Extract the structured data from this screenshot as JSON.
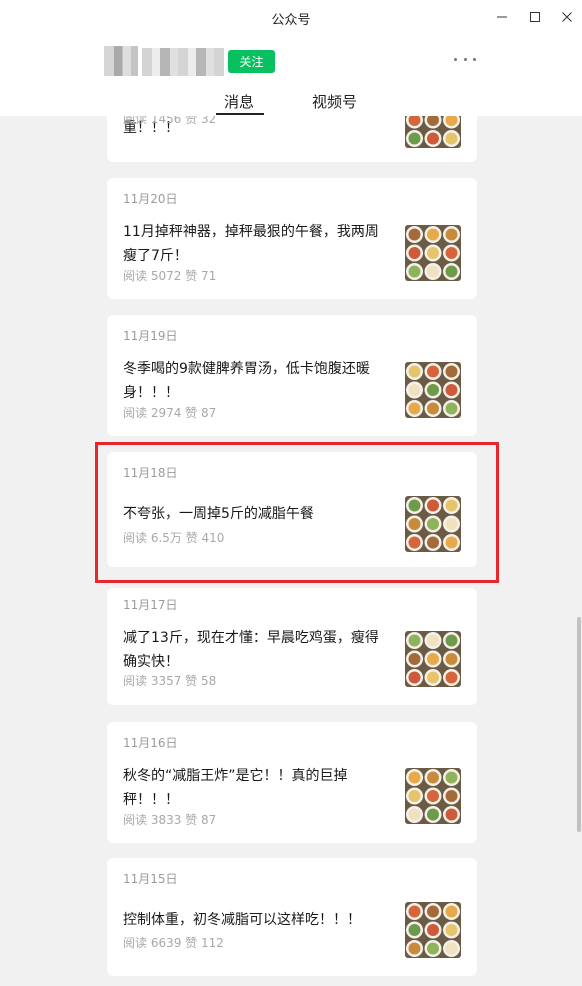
{
  "window": {
    "title": "公众号"
  },
  "account": {
    "name": "[blurred]",
    "follow_label": "关注"
  },
  "tabs": [
    {
      "label": "消息"
    },
    {
      "label": "视频号"
    }
  ],
  "articles": [
    {
      "date": "",
      "title": "重！！！",
      "stats": "阅读 1456  赞 32",
      "thumb": "food-photo"
    },
    {
      "date": "11月20日",
      "title": "11月掉秤神器，掉秤最狠的午餐，我两周瘦了7斤！",
      "stats": "阅读 5072  赞 71",
      "thumb": "food-photo"
    },
    {
      "date": "11月19日",
      "title": "冬季喝的9款健脾养胃汤，低卡饱腹还暖身！！！",
      "stats": "阅读 2974  赞 87",
      "thumb": "food-photo"
    },
    {
      "date": "11月18日",
      "title": "不夸张，一周掉5斤的减脂午餐",
      "stats": "阅读 6.5万  赞 410",
      "thumb": "food-photo",
      "highlighted": true
    },
    {
      "date": "11月17日",
      "title": "减了13斤，现在才懂：早晨吃鸡蛋，瘦得确实快！",
      "stats": "阅读 3357  赞 58",
      "thumb": "food-photo"
    },
    {
      "date": "11月16日",
      "title": "秋冬的“减脂王炸”是它！！真的巨掉秤！！！",
      "stats": "阅读 3833  赞 87",
      "thumb": "food-photo"
    },
    {
      "date": "11月15日",
      "title": "控制体重，初冬减脂可以这样吃！！！",
      "stats": "阅读 6639  赞 112",
      "thumb": "food-photo"
    }
  ],
  "colors": {
    "accent": "#07c160",
    "highlight": "#e8272c",
    "background": "#f1f1f1"
  }
}
